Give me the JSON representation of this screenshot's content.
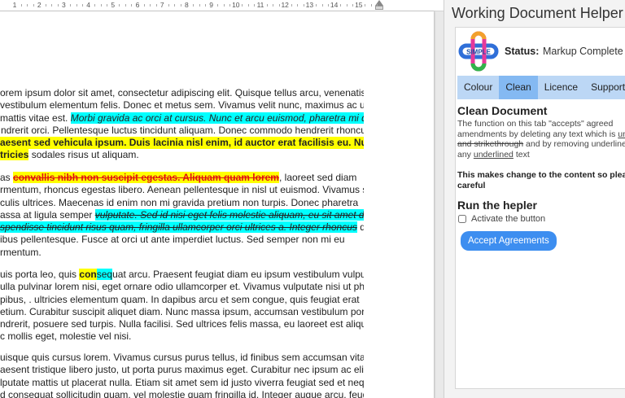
{
  "ruler": {
    "numbers": [
      "1",
      "2",
      "3",
      "4",
      "5",
      "6",
      "7",
      "8",
      "9",
      "10",
      "11",
      "12",
      "13",
      "14",
      "15"
    ]
  },
  "panel": {
    "title": "Working Document Helper",
    "logo_text": "SIMPLE",
    "status_label": "Status:",
    "status_value": "Markup Complete",
    "tabs": [
      {
        "label": "Colour",
        "active": false
      },
      {
        "label": "Clean",
        "active": true
      },
      {
        "label": "Licence",
        "active": false
      },
      {
        "label": "Support",
        "active": false
      }
    ],
    "clean": {
      "title": "Clean Document",
      "desc_line1": "The function on this tab \"accepts\" agreed",
      "desc_line2_a": "amendments by deleting any text which is ",
      "desc_line2_b": "un",
      "desc_line3_a": "and strikethrough",
      "desc_line3_b": " and by removing underline",
      "desc_line4_a": "any ",
      "desc_line4_b": "underlined",
      "desc_line4_c": " text",
      "warning_line1": "This makes change to the content so plea",
      "warning_line2": "careful",
      "run_title": "Run the hepler",
      "activate_label": "Activate the button",
      "accept_button": "Accept Agreements"
    },
    "colors": {
      "tab_bar": "#bcd7f5",
      "tab_active": "#84b9f2",
      "button": "#3d8ef0",
      "highlight_yellow": "#ffff00",
      "highlight_cyan": "#00ffff",
      "deleted_red": "#e01010"
    }
  },
  "document": {
    "p1": {
      "l1": "orem ipsum dolor sit amet, consectetur adipiscing elit. Quisque tellus arcu, venenatis at nibh",
      "l2": " vestibulum elementum felis. Donec et metus sem. Vivamus velit nunc, maximus ac ultrices",
      "l3_a": " mattis vitae est. ",
      "l3_b": "Morbi gravida ac orci at cursus. Nunc et arcu euismod, pharetra mi quis,",
      "l4_a": "ndrerit orci. Pellentesque luctus tincidunt aliquam. Donec commodo hendrerit rhoncus.",
      "l5": "aesent sed vehicula ipsum. Duis lacinia nisl enim, id auctor erat facilisis eu. Nullam",
      "l6_a": "tricies",
      "l6_b": " sodales risus ut aliquam."
    },
    "p2": {
      "l1_a": "as ",
      "l1_b": "convallis nibh non suscipit egestas. Aliquam quam lorem",
      "l1_c": ", laoreet sed diam",
      "l2": "rmentum, rhoncus egestas libero. Aenean pellentesque in nisl ut euismod. Vivamus suscipit",
      "l3": "culis ultrices. Maecenas id enim non mi gravida pretium non turpis. Donec pharetra",
      "l4_a": "assa at ligula semper ",
      "l4_b": "vulputate. Sed id nisi eget felis molestie aliquam, eu sit amet dolor.",
      "l5_a": "spendisse tincidunt risus quam, fringilla ullamcorper orci ultrices a. Integer rhoncus",
      "l5_b": " diam quis",
      "l6": "ibus pellentesque. Fusce at orci ut ante imperdiet luctus. Sed semper non mi eu",
      "l7": "rmentum."
    },
    "p3": {
      "l1_a": "uis porta leo, quis ",
      "l1_b": "con",
      "l1_c": "seq",
      "l1_d": "uat arcu. Praesent feugiat diam eu ipsum vestibulum vulputate.",
      "l2": "ulla pulvinar lorem nisi, eget ornare odio ullamcorper et. Vivamus vulputate nisi ut pharetra",
      "l3": "pibus, . ultricies elementum quam. In dapibus arcu et sem congue, quis feugiat erat",
      "l4": "etium. Curabitur suscipit aliquet diam. Nunc massa ipsum, accumsan vestibulum porta",
      "l5": "ndrerit, posuere sed turpis. Nulla facilisi. Sed ultrices felis massa, eu laoreet est aliquet et",
      "l6": "c mollis eget, molestie vel nisi."
    },
    "p4": {
      "l1": "uisque quis cursus lorem. Vivamus cursus purus tellus, id finibus sem accumsan vitae.",
      "l2": "aesent tristique libero justo, ut porta purus maximus eget. Curabitur nec ipsum ac elit",
      "l3": "lputate mattis ut placerat nulla. Etiam sit amet sem id justo viverra feugiat sed et neque.",
      "l4": "d consequat sollicitudin quam, vel molestie quam fringilla id. Integer augue arcu, feugiat"
    }
  }
}
